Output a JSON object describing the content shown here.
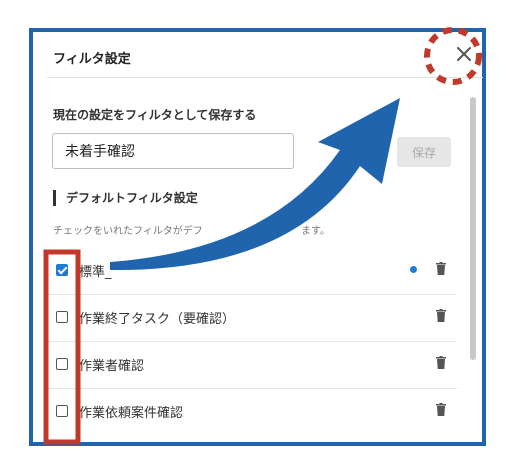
{
  "dialog": {
    "title": "フィルタ設定",
    "close_icon": "close-icon"
  },
  "save_section": {
    "title": "現在の設定をフィルタとして保存する",
    "input_value": "未着手確認",
    "save_label": "保存"
  },
  "default_section": {
    "title": "デフォルトフィルタ設定",
    "help_text": "チェックをいれたフィルタがデフ",
    "help_text_tail": "ます。"
  },
  "filters": [
    {
      "label": "標準_",
      "checked": true,
      "is_default": true
    },
    {
      "label": "作業終了タスク（要確認）",
      "checked": false,
      "is_default": false
    },
    {
      "label": "作業者確認",
      "checked": false,
      "is_default": false
    },
    {
      "label": "作業依頼案件確認",
      "checked": false,
      "is_default": false
    }
  ],
  "colors": {
    "frame": "#1f64ad",
    "arrow": "#1f64ad",
    "highlight": "#c0392b",
    "accent": "#1f7ad6"
  }
}
